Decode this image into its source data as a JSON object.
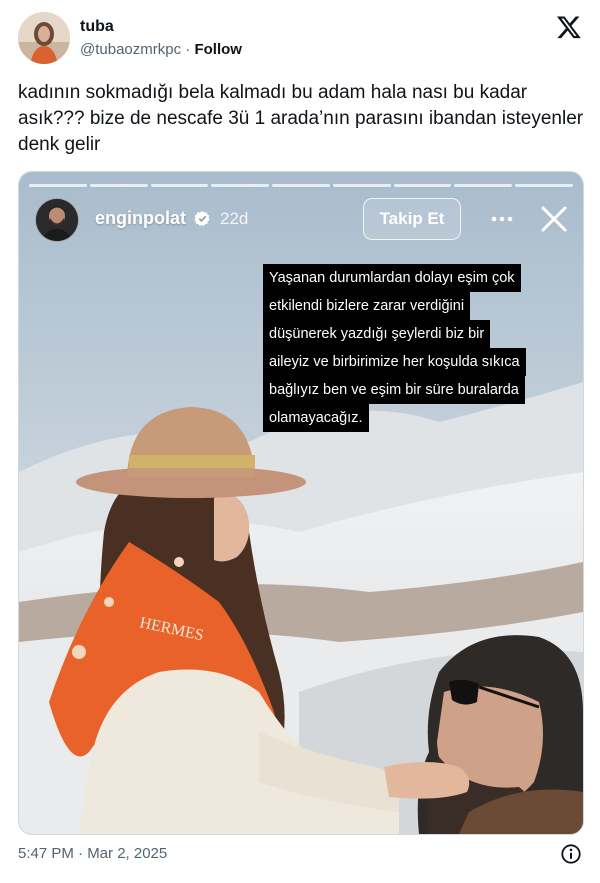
{
  "tweet": {
    "author_name": "tuba",
    "author_handle": "@tubaozmrkpc",
    "separator": "·",
    "follow_label": "Follow",
    "text": "kadının sokmadığı bela kalmadı bu adam hala nası bu kadar asık??? bize de nescafe 3ü 1 arada’nın parasını ibandan isteyenler denk gelir",
    "timestamp": "5:47 PM · Mar 2, 2025"
  },
  "story": {
    "username": "enginpolat",
    "time_ago": "22d",
    "follow_button": "Takip Et",
    "progress_segments": 9,
    "caption_lines": [
      "Yaşanan durumlardan dolayı eşim çok",
      "etkilendi bizlere zarar verdiğini",
      "düşünerek yazdığı şeylerdi biz bir",
      "aileyiz ve birbirimize her koşulda sıkıca",
      "bağlıyız ben ve eşim bir süre buralarda",
      "olamayacağız."
    ],
    "scarf_text": "HERMES"
  },
  "icons": {
    "x_logo": "x-logo-icon",
    "verified": "verified-badge-icon",
    "more": "more-horizontal-icon",
    "close": "close-icon",
    "info": "info-icon"
  },
  "colors": {
    "text": "#0f1419",
    "secondary": "#536471",
    "scarf_orange": "#e8622a",
    "hat": "#c79a78"
  }
}
